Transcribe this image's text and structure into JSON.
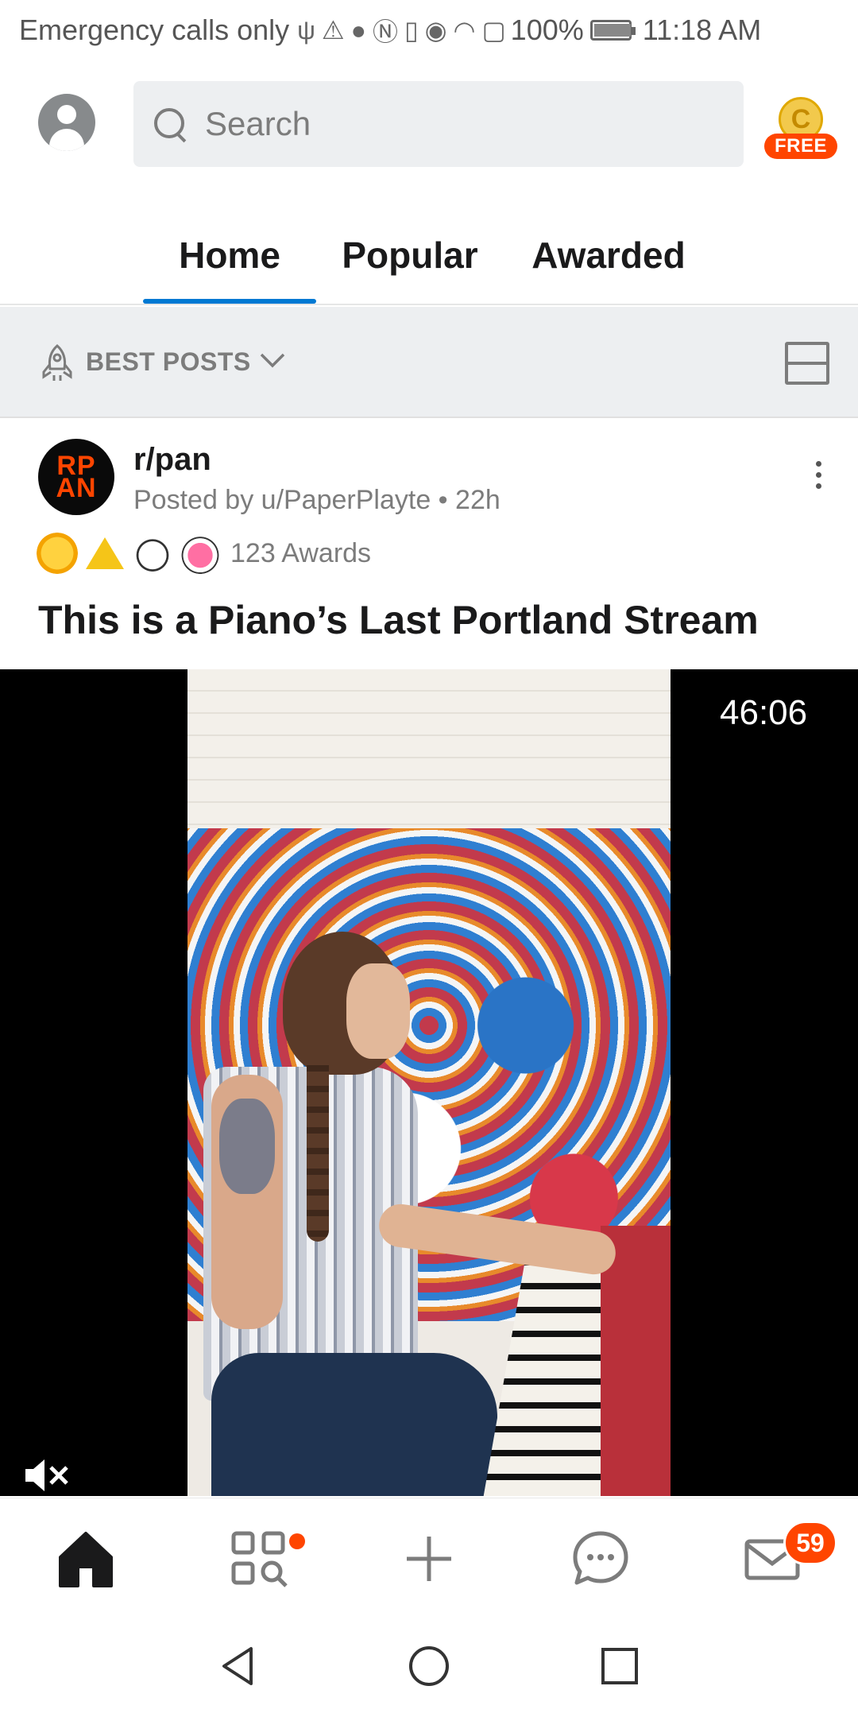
{
  "status_bar": {
    "carrier": "Emergency calls only",
    "battery": "100%",
    "time": "11:18 AM"
  },
  "header": {
    "search_placeholder": "Search",
    "coin_letter": "C",
    "coin_label": "FREE"
  },
  "tabs": [
    {
      "label": "Home",
      "selected": true
    },
    {
      "label": "Popular",
      "selected": false
    },
    {
      "label": "Awarded",
      "selected": false
    }
  ],
  "sort": {
    "label": "BEST POSTS"
  },
  "post": {
    "subreddit_icon_text": [
      "RP",
      "AN"
    ],
    "subreddit": "r/pan",
    "posted_by": "Posted by u/PaperPlayte • 22h",
    "awards_count": "123 Awards",
    "title": "This is a Piano’s Last Portland Stream",
    "video_duration": "46:06"
  },
  "bottom_nav": {
    "inbox_badge": "59"
  },
  "colors": {
    "accent_blue": "#0079d3",
    "reddit_orange": "#ff4500",
    "muted_text": "#7c7c7c"
  },
  "icons": {
    "avatar": "user-avatar-icon",
    "search": "search-icon",
    "sort": "rocket-icon",
    "view": "card-layout-icon",
    "more": "more-vertical-icon",
    "mute": "volume-muted-icon",
    "nav": [
      "home-icon",
      "communities-icon",
      "create-icon",
      "chat-icon",
      "inbox-icon"
    ],
    "system": [
      "back-icon",
      "home-circle-icon",
      "recents-icon"
    ]
  }
}
